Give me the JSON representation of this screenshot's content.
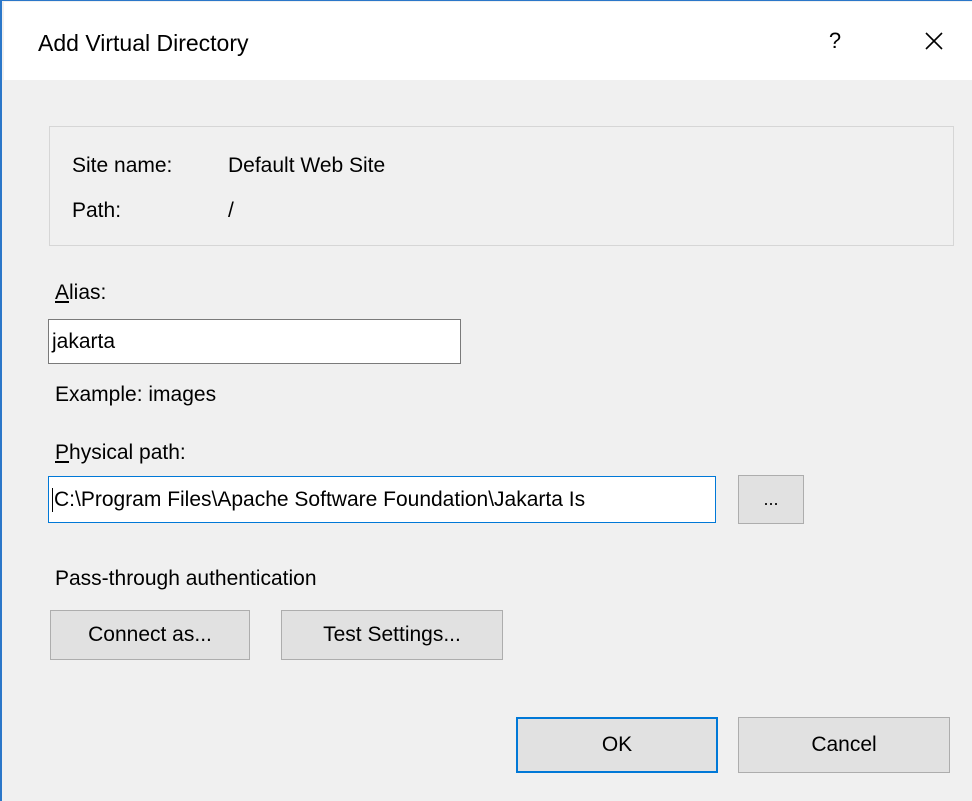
{
  "window": {
    "title": "Add Virtual Directory",
    "help_label": "?",
    "close_icon": "close-icon"
  },
  "info": {
    "site_name_label": "Site name:",
    "site_name_value": "Default Web Site",
    "path_label": "Path:",
    "path_value": "/"
  },
  "alias": {
    "label": "Alias:",
    "value": "jakarta",
    "example": "Example: images"
  },
  "physical_path": {
    "label": "Physical path:",
    "value": "C:\\Program Files\\Apache Software Foundation\\Jakarta Is",
    "browse_label": "..."
  },
  "auth": {
    "label": "Pass-through authentication",
    "connect_as_label": "Connect as...",
    "test_settings_label": "Test Settings..."
  },
  "footer": {
    "ok_label": "OK",
    "cancel_label": "Cancel"
  },
  "colors": {
    "accent": "#0078d7",
    "window_border": "#2b77c9",
    "background": "#f0f0f0"
  }
}
